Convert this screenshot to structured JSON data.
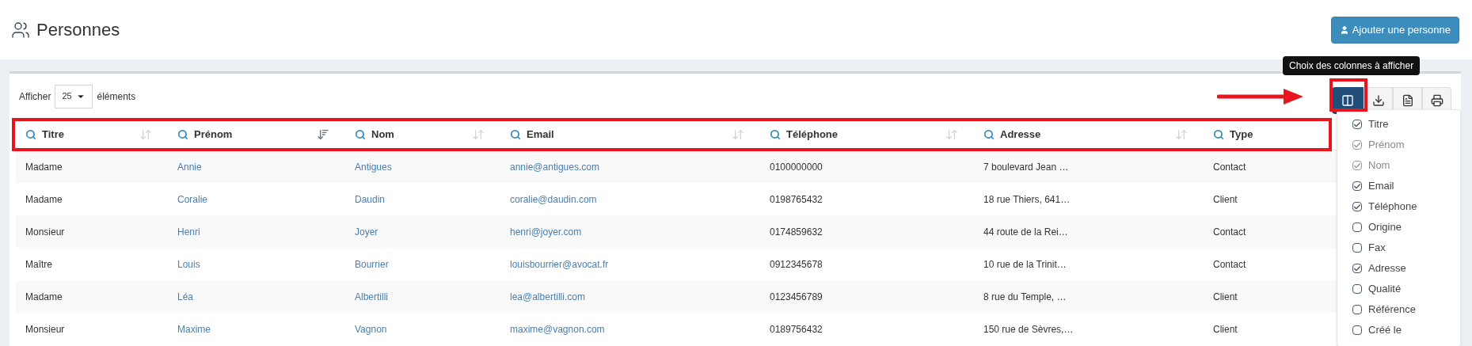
{
  "page": {
    "title": "Personnes",
    "add_button": "Ajouter une personne"
  },
  "length_control": {
    "before": "Afficher",
    "value": "25",
    "after": "éléments"
  },
  "tooltip": "Choix des colonnes à afficher",
  "table": {
    "columns": [
      {
        "label": "Titre",
        "sorted": false,
        "link": false
      },
      {
        "label": "Prénom",
        "sorted": true,
        "link": true
      },
      {
        "label": "Nom",
        "sorted": false,
        "link": true
      },
      {
        "label": "Email",
        "sorted": false,
        "link": true
      },
      {
        "label": "Téléphone",
        "sorted": false,
        "link": false
      },
      {
        "label": "Adresse",
        "sorted": false,
        "link": false
      },
      {
        "label": "Type",
        "link": false
      }
    ],
    "rows": [
      [
        "Madame",
        "Annie",
        "Antigues",
        "annie@antigues.com",
        "0100000000",
        "7 boulevard Jean …",
        "Contact"
      ],
      [
        "Madame",
        "Coralie",
        "Daudin",
        "coralie@daudin.com",
        "0198765432",
        "18 rue Thiers, 641…",
        "Client"
      ],
      [
        "Monsieur",
        "Henri",
        "Joyer",
        "henri@joyer.com",
        "0174859632",
        "44 route de la Rei…",
        "Contact"
      ],
      [
        "Maître",
        "Louis",
        "Bourrier",
        "louisbourrier@avocat.fr",
        "0912345678",
        "10 rue de la Trinit…",
        "Contact"
      ],
      [
        "Madame",
        "Léa",
        "Albertilli",
        "lea@albertilli.com",
        "0123456789",
        "8 rue du Temple, …",
        "Client"
      ],
      [
        "Monsieur",
        "Maxime",
        "Vagnon",
        "maxime@vagnon.com",
        "0189756432",
        "150 rue de Sèvres,…",
        "Client"
      ]
    ]
  },
  "column_menu": {
    "items": [
      {
        "label": "Titre",
        "checked": true,
        "disabled": false
      },
      {
        "label": "Prénom",
        "checked": true,
        "disabled": true
      },
      {
        "label": "Nom",
        "checked": true,
        "disabled": true
      },
      {
        "label": "Email",
        "checked": true,
        "disabled": false
      },
      {
        "label": "Téléphone",
        "checked": true,
        "disabled": false
      },
      {
        "label": "Origine",
        "checked": false,
        "disabled": false
      },
      {
        "label": "Fax",
        "checked": false,
        "disabled": false
      },
      {
        "label": "Adresse",
        "checked": true,
        "disabled": false
      },
      {
        "label": "Qualité",
        "checked": false,
        "disabled": false
      },
      {
        "label": "Référence",
        "checked": false,
        "disabled": false
      },
      {
        "label": "Créé le",
        "checked": false,
        "disabled": false
      }
    ]
  }
}
